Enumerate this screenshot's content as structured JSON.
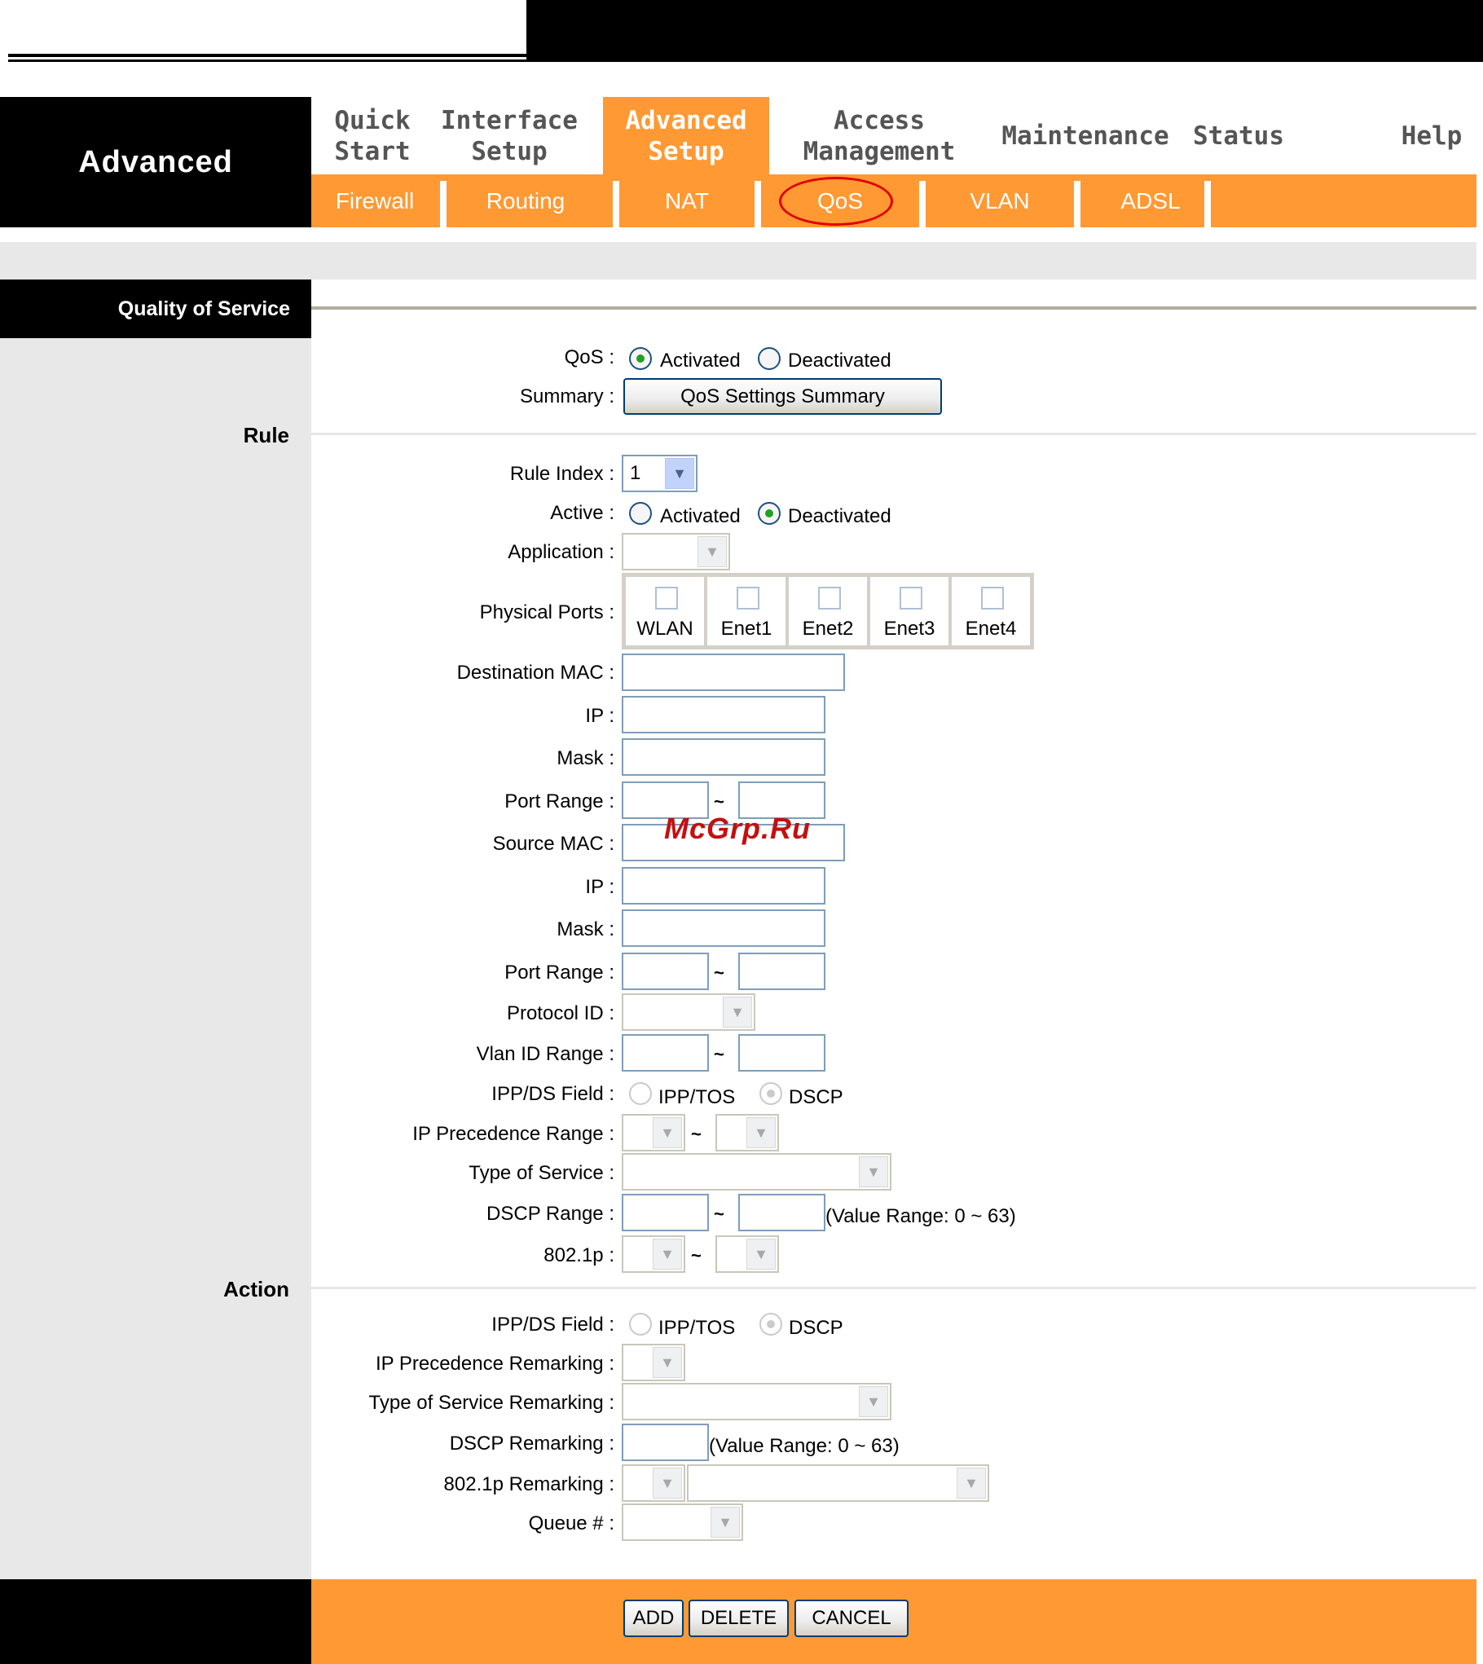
{
  "header": {
    "brand": "Advanced",
    "nav": [
      {
        "label": "Quick\nStart"
      },
      {
        "label": "Interface\nSetup"
      },
      {
        "label": "Advanced\nSetup"
      },
      {
        "label": "Access\nManagement"
      },
      {
        "label": "Maintenance"
      },
      {
        "label": "Status"
      },
      {
        "label": "Help"
      }
    ],
    "active_nav": "Advanced Setup",
    "subnav": [
      {
        "label": "Firewall"
      },
      {
        "label": "Routing"
      },
      {
        "label": "NAT"
      },
      {
        "label": "QoS"
      },
      {
        "label": "VLAN"
      },
      {
        "label": "ADSL"
      }
    ],
    "highlighted_subnav": "QoS"
  },
  "section_title": "Quality of Service",
  "qos": {
    "label": "QoS :",
    "options": [
      "Activated",
      "Deactivated"
    ],
    "selected": "Activated",
    "summary_label": "Summary :",
    "summary_button": "QoS Settings Summary"
  },
  "rule": {
    "heading": "Rule",
    "rule_index_label": "Rule Index :",
    "rule_index_value": "1",
    "active_label": "Active :",
    "active_options": [
      "Activated",
      "Deactivated"
    ],
    "active_selected": "Deactivated",
    "application_label": "Application :",
    "physical_ports_label": "Physical Ports :",
    "ports": [
      "WLAN",
      "Enet1",
      "Enet2",
      "Enet3",
      "Enet4"
    ],
    "dest_mac_label": "Destination MAC :",
    "dest_ip_label": "IP :",
    "dest_mask_label": "Mask :",
    "dest_port_range_label": "Port Range :",
    "src_mac_label": "Source MAC :",
    "src_ip_label": "IP :",
    "src_mask_label": "Mask :",
    "src_port_range_label": "Port Range :",
    "protocol_id_label": "Protocol ID :",
    "vlan_id_range_label": "Vlan ID Range :",
    "ippds_label": "IPP/DS Field :",
    "ippds_options": [
      "IPP/TOS",
      "DSCP"
    ],
    "ippds_selected": "DSCP",
    "ip_precedence_range_label": "IP Precedence Range :",
    "type_of_service_label": "Type of Service :",
    "dscp_range_label": "DSCP Range :",
    "dscp_range_note": "(Value Range: 0 ~ 63)",
    "dot1p_label": "802.1p :",
    "tilde": "~"
  },
  "action": {
    "heading": "Action",
    "ippds_label": "IPP/DS Field :",
    "ippds_options": [
      "IPP/TOS",
      "DSCP"
    ],
    "ippds_selected": "DSCP",
    "ip_precedence_remarking_label": "IP Precedence Remarking :",
    "tos_remarking_label": "Type of Service Remarking :",
    "dscp_remarking_label": "DSCP Remarking :",
    "dscp_remarking_note": "(Value Range: 0 ~ 63)",
    "dot1p_remarking_label": "802.1p Remarking :",
    "queue_label": "Queue # :"
  },
  "footer": {
    "buttons": [
      "ADD",
      "DELETE",
      "CANCEL"
    ]
  },
  "watermark": "McGrp.Ru",
  "colors": {
    "accent": "#ff9933",
    "header_bg": "#000000",
    "panel_grey": "#e8e8e8",
    "highlight_ring": "#e00000"
  }
}
